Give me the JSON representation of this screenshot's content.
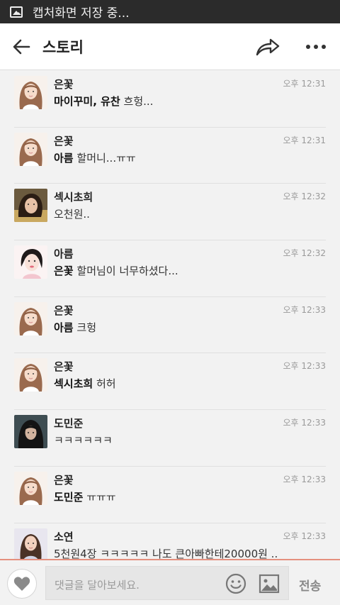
{
  "status_bar": {
    "text": "캡처화면 저장 중..."
  },
  "header": {
    "title": "스토리"
  },
  "comments": [
    {
      "avatar": "girl-brown-hair",
      "name": "은꽃",
      "time": "오후 12:31",
      "tag": "마이꾸미, 유찬",
      "text": "흐헝..."
    },
    {
      "avatar": "girl-brown-hair",
      "name": "은꽃",
      "time": "오후 12:31",
      "tag": "아름",
      "text": "할머니...ㅠㅠ"
    },
    {
      "avatar": "girl-dark",
      "name": "섹시초희",
      "time": "오후 12:32",
      "tag": "",
      "text": "오천원.."
    },
    {
      "avatar": "girl-pink",
      "name": "아름",
      "time": "오후 12:32",
      "tag": "은꽃",
      "text": "할머님이 너무하셨다..."
    },
    {
      "avatar": "girl-brown-hair",
      "name": "은꽃",
      "time": "오후 12:33",
      "tag": "아름",
      "text": "크헝"
    },
    {
      "avatar": "girl-brown-hair",
      "name": "은꽃",
      "time": "오후 12:33",
      "tag": "섹시초희",
      "text": "허허"
    },
    {
      "avatar": "person-hood",
      "name": "도민준",
      "time": "오후 12:33",
      "tag": "",
      "text": "ㅋㅋㅋㅋㅋㅋ"
    },
    {
      "avatar": "girl-brown-hair",
      "name": "은꽃",
      "time": "오후 12:33",
      "tag": "도민준",
      "text": "ㅠㅠㅠ"
    },
    {
      "avatar": "girl-long-hair",
      "name": "소연",
      "time": "오후 12:33",
      "tag": "",
      "text": "5천원4장 ㅋㅋㅋㅋㅋ 나도 큰아빠한테20000원 .."
    }
  ],
  "input_bar": {
    "placeholder": "댓글을 달아보세요.",
    "send_label": "전송"
  },
  "colors": {
    "accent_line": "#e5907e",
    "background": "#f2f2f2",
    "header": "#ffffff",
    "status_bar": "#2b2b2b"
  }
}
